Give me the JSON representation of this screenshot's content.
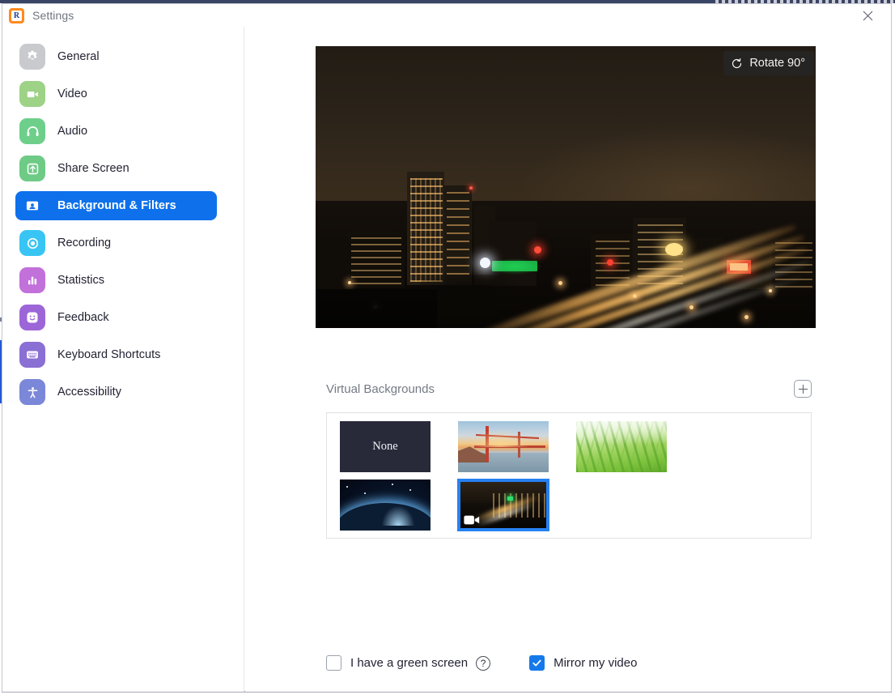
{
  "window": {
    "title": "Settings",
    "logo_icon": "app-logo-r-icon",
    "close_icon": "close-icon"
  },
  "sidebar": {
    "items": [
      {
        "label": "General",
        "icon": "gear-icon",
        "icon_class": "ic-general",
        "active": false
      },
      {
        "label": "Video",
        "icon": "video-camera-icon",
        "icon_class": "ic-video",
        "active": false
      },
      {
        "label": "Audio",
        "icon": "headphones-icon",
        "icon_class": "ic-audio",
        "active": false
      },
      {
        "label": "Share Screen",
        "icon": "upload-arrow-icon",
        "icon_class": "ic-share",
        "active": false
      },
      {
        "label": "Background & Filters",
        "icon": "person-card-icon",
        "icon_class": "ic-bg",
        "active": true
      },
      {
        "label": "Recording",
        "icon": "record-circle-icon",
        "icon_class": "ic-recording",
        "active": false
      },
      {
        "label": "Statistics",
        "icon": "bar-chart-icon",
        "icon_class": "ic-stats",
        "active": false
      },
      {
        "label": "Feedback",
        "icon": "smiley-face-icon",
        "icon_class": "ic-feedback",
        "active": false
      },
      {
        "label": "Keyboard Shortcuts",
        "icon": "keyboard-icon",
        "icon_class": "ic-keyboard",
        "active": false
      },
      {
        "label": "Accessibility",
        "icon": "accessibility-icon",
        "icon_class": "ic-access",
        "active": false
      }
    ]
  },
  "preview": {
    "rotate_label": "Rotate 90°",
    "rotate_icon": "rotate-ccw-icon",
    "description": "night city skyline with illuminated highway traffic"
  },
  "virtual_backgrounds": {
    "title": "Virtual Backgrounds",
    "add_label": "+",
    "add_icon": "plus-square-icon",
    "thumbnails": [
      {
        "label": "None",
        "kind": "none",
        "selected": false
      },
      {
        "label": "Golden Gate Bridge",
        "kind": "gg",
        "selected": false
      },
      {
        "label": "Grass",
        "kind": "grass",
        "selected": false
      },
      {
        "label": "Earth from space",
        "kind": "earth",
        "selected": false
      },
      {
        "label": "City at night",
        "kind": "city",
        "selected": true,
        "badge_icon": "video-camera-badge-icon"
      }
    ]
  },
  "options": {
    "green_screen": {
      "label": "I have a green screen",
      "checked": false,
      "help_icon": "question-mark-icon",
      "help_label": "?"
    },
    "mirror_video": {
      "label": "Mirror my video",
      "checked": true,
      "check_glyph": "✓"
    }
  },
  "colors": {
    "accent": "#0e71eb",
    "selected_thumb_border": "#2681f2",
    "checkbox_checked": "#1479ea",
    "logo_orange": "#ff8a1e",
    "title_text": "#6f7480"
  }
}
